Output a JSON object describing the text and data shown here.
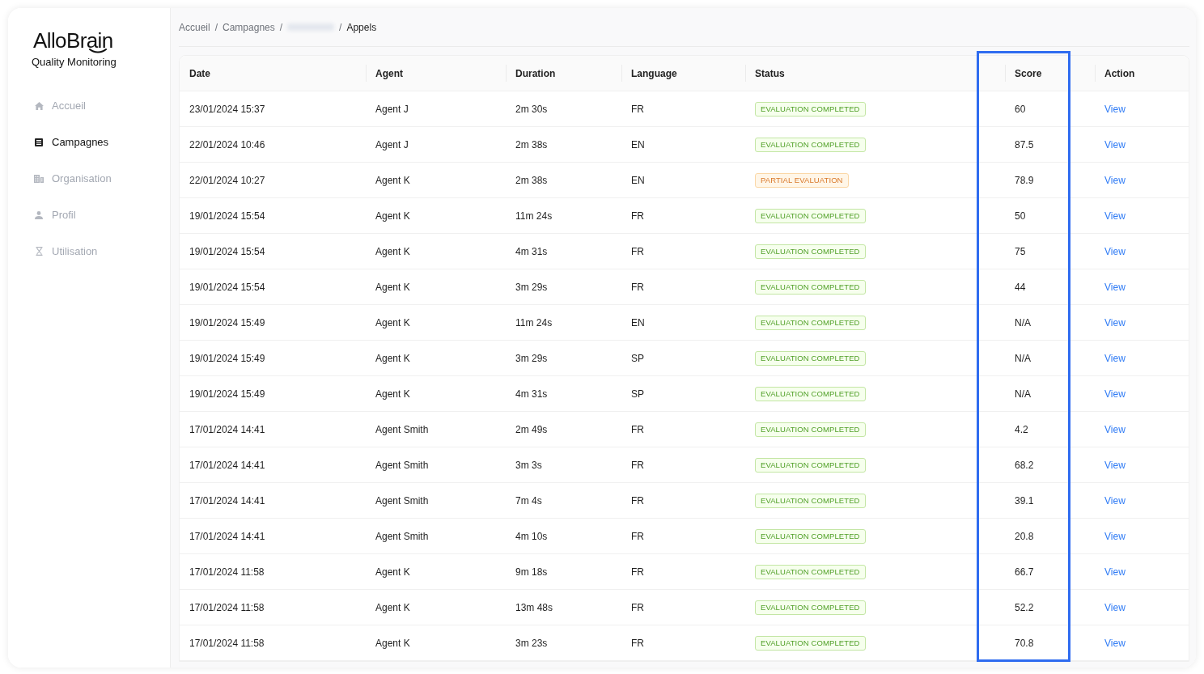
{
  "sidebar": {
    "logo": {
      "name": "AlloBrain",
      "subtitle": "Quality Monitoring"
    },
    "items": [
      {
        "label": "Accueil",
        "selected": false
      },
      {
        "label": "Campagnes",
        "selected": true
      },
      {
        "label": "Organisation",
        "selected": false
      },
      {
        "label": "Profil",
        "selected": false
      },
      {
        "label": "Utilisation",
        "selected": false
      }
    ]
  },
  "breadcrumb": {
    "items": [
      {
        "kind": "link",
        "label": "Accueil"
      },
      {
        "kind": "link",
        "label": "Campagnes"
      },
      {
        "kind": "redacted"
      },
      {
        "kind": "current",
        "label": "Appels"
      }
    ],
    "separators": [
      "/",
      "/",
      "/"
    ]
  },
  "table": {
    "columns": [
      {
        "label": "Date",
        "highlighted": false
      },
      {
        "label": "Agent",
        "highlighted": false
      },
      {
        "label": "Duration",
        "highlighted": false
      },
      {
        "label": "Language",
        "highlighted": false
      },
      {
        "label": "Status",
        "highlighted": false
      },
      {
        "label": "Score",
        "highlighted": true
      },
      {
        "label": "Action",
        "highlighted": false
      }
    ],
    "rows": [
      {
        "date": "23/01/2024 15:37",
        "agent": "Agent J",
        "duration": "2m 30s",
        "language": "FR",
        "status": {
          "kind": "completed",
          "label": "EVALUATION COMPLETED"
        },
        "score": "60",
        "action": "View"
      },
      {
        "date": "22/01/2024 10:46",
        "agent": "Agent J",
        "duration": "2m 38s",
        "language": "EN",
        "status": {
          "kind": "completed",
          "label": "EVALUATION COMPLETED"
        },
        "score": "87.5",
        "action": "View"
      },
      {
        "date": "22/01/2024 10:27",
        "agent": "Agent K",
        "duration": "2m 38s",
        "language": "EN",
        "status": {
          "kind": "partial",
          "label": "PARTIAL EVALUATION"
        },
        "score": "78.9",
        "action": "View"
      },
      {
        "date": "19/01/2024 15:54",
        "agent": "Agent K",
        "duration": "11m 24s",
        "language": "FR",
        "status": {
          "kind": "completed",
          "label": "EVALUATION COMPLETED"
        },
        "score": "50",
        "action": "View"
      },
      {
        "date": "19/01/2024 15:54",
        "agent": "Agent K",
        "duration": "4m 31s",
        "language": "FR",
        "status": {
          "kind": "completed",
          "label": "EVALUATION COMPLETED"
        },
        "score": "75",
        "action": "View"
      },
      {
        "date": "19/01/2024 15:54",
        "agent": "Agent K",
        "duration": "3m 29s",
        "language": "FR",
        "status": {
          "kind": "completed",
          "label": "EVALUATION COMPLETED"
        },
        "score": "44",
        "action": "View"
      },
      {
        "date": "19/01/2024 15:49",
        "agent": "Agent K",
        "duration": "11m 24s",
        "language": "EN",
        "status": {
          "kind": "completed",
          "label": "EVALUATION COMPLETED"
        },
        "score": "N/A",
        "action": "View"
      },
      {
        "date": "19/01/2024 15:49",
        "agent": "Agent K",
        "duration": "3m 29s",
        "language": "SP",
        "status": {
          "kind": "completed",
          "label": "EVALUATION COMPLETED"
        },
        "score": "N/A",
        "action": "View"
      },
      {
        "date": "19/01/2024 15:49",
        "agent": "Agent K",
        "duration": "4m 31s",
        "language": "SP",
        "status": {
          "kind": "completed",
          "label": "EVALUATION COMPLETED"
        },
        "score": "N/A",
        "action": "View"
      },
      {
        "date": "17/01/2024 14:41",
        "agent": "Agent Smith",
        "duration": "2m 49s",
        "language": "FR",
        "status": {
          "kind": "completed",
          "label": "EVALUATION COMPLETED"
        },
        "score": "4.2",
        "action": "View"
      },
      {
        "date": "17/01/2024 14:41",
        "agent": "Agent Smith",
        "duration": "3m 3s",
        "language": "FR",
        "status": {
          "kind": "completed",
          "label": "EVALUATION COMPLETED"
        },
        "score": "68.2",
        "action": "View"
      },
      {
        "date": "17/01/2024 14:41",
        "agent": "Agent Smith",
        "duration": "7m 4s",
        "language": "FR",
        "status": {
          "kind": "completed",
          "label": "EVALUATION COMPLETED"
        },
        "score": "39.1",
        "action": "View"
      },
      {
        "date": "17/01/2024 14:41",
        "agent": "Agent Smith",
        "duration": "4m 10s",
        "language": "FR",
        "status": {
          "kind": "completed",
          "label": "EVALUATION COMPLETED"
        },
        "score": "20.8",
        "action": "View"
      },
      {
        "date": "17/01/2024 11:58",
        "agent": "Agent K",
        "duration": "9m 18s",
        "language": "FR",
        "status": {
          "kind": "completed",
          "label": "EVALUATION COMPLETED"
        },
        "score": "66.7",
        "action": "View"
      },
      {
        "date": "17/01/2024 11:58",
        "agent": "Agent K",
        "duration": "13m 48s",
        "language": "FR",
        "status": {
          "kind": "completed",
          "label": "EVALUATION COMPLETED"
        },
        "score": "52.2",
        "action": "View"
      },
      {
        "date": "17/01/2024 11:58",
        "agent": "Agent K",
        "duration": "3m 23s",
        "language": "FR",
        "status": {
          "kind": "completed",
          "label": "EVALUATION COMPLETED"
        },
        "score": "70.8",
        "action": "View"
      }
    ]
  }
}
